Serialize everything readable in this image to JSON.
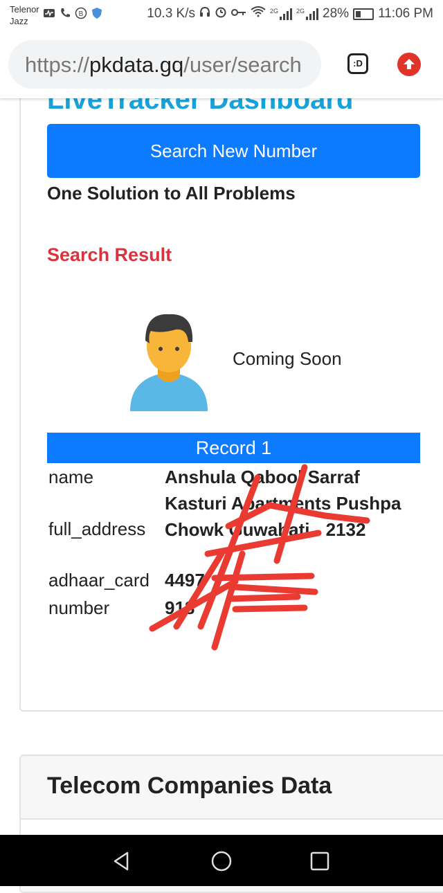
{
  "status_bar": {
    "carrier_line1": "Telenor",
    "carrier_line2": "Jazz",
    "speed": "10.3 K/s",
    "net1": "2G",
    "net2": "2G",
    "battery": "28%",
    "time": "11:06 PM"
  },
  "browser": {
    "url_scheme": "https://",
    "url_host": "pkdata.gq",
    "url_path": "/user/search",
    "tabs_label": ":D"
  },
  "page": {
    "dashboard_title": "LiveTracker Dashboard",
    "search_button": "Search New Number",
    "tagline": "One Solution to All Problems",
    "result_title": "Search Result",
    "coming_soon": "Coming Soon"
  },
  "record": {
    "header": "Record 1",
    "rows": [
      {
        "key": "name",
        "value": "Anshula Qabool Sarraf"
      },
      {
        "key": "full_address",
        "value": "Kasturi Apartments Pushpa Chowk Guwahati - 2132"
      },
      {
        "key": "adhaar_card",
        "value": "4497"
      },
      {
        "key": "number",
        "value": "918"
      }
    ]
  },
  "telecom": {
    "title": "Telecom Companies Data"
  },
  "colors": {
    "primary": "#0d7bff",
    "danger": "#d9343e",
    "title_blue": "#18a2d8",
    "scribble_red": "#ea3b32"
  }
}
